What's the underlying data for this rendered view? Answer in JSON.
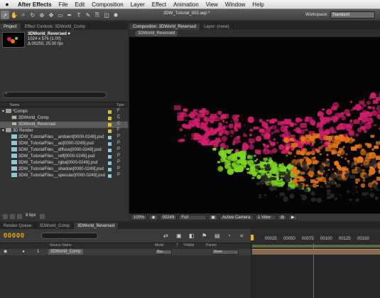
{
  "menubar": {
    "app": "After Effects",
    "items": [
      "File",
      "Edit",
      "Composition",
      "Layer",
      "Effect",
      "Animation",
      "View",
      "Window",
      "Help"
    ]
  },
  "toolbar": {
    "doc_title": "3DW_Tutorial_002.aep *",
    "workspace_label": "Workspace:",
    "workspace_value": "Standard"
  },
  "project": {
    "tabs": [
      "Project",
      "Effect Controls: 3DWorld_Comp"
    ],
    "selected_name": "3DWorld_Reversed ▾",
    "selected_size": "1024 x 576 (1.00)",
    "selected_time": "Δ 00250, 25.00 fps",
    "column_name": "Name",
    "column_type": "Type",
    "items": [
      {
        "name": "*Comps",
        "kind": "folder",
        "type": "F"
      },
      {
        "name": "3DWorld_Comp",
        "kind": "comp",
        "type": "C"
      },
      {
        "name": "3DWorld_Reversed",
        "kind": "comp",
        "type": "C"
      },
      {
        "name": "3D Render",
        "kind": "folder",
        "type": "F"
      },
      {
        "name": "3DW_TutorialFiles__ambient[0000-0249].psd",
        "kind": "file",
        "type": "P"
      },
      {
        "name": "3DW_TutorialFiles__ao[0000-0249].psd",
        "kind": "file",
        "type": "P"
      },
      {
        "name": "3DW_TutorialFiles__diffuse[0000-0249].psd",
        "kind": "file",
        "type": "P"
      },
      {
        "name": "3DW_TutorialFiles__refl[0000-0249].psd",
        "kind": "file",
        "type": "P"
      },
      {
        "name": "3DW_TutorialFiles__rgba[0000-0249].psd",
        "kind": "file",
        "type": "P"
      },
      {
        "name": "3DW_TutorialFiles__shadow[0000-0249].psd",
        "kind": "file",
        "type": "P"
      },
      {
        "name": "3DW_TutorialFiles__specular[0000-0249].psd",
        "kind": "file",
        "type": "P"
      }
    ],
    "bpc": "8 bpc"
  },
  "composition": {
    "tabs": [
      "Composition: 3DWorld_Reversed",
      "Layer: (none)"
    ],
    "breadcrumb": "3DWorld_Reversed",
    "bottom": {
      "zoom": "100%",
      "timecode": "00249",
      "resolution": "Full",
      "camera": "Active Camera",
      "views": "1 View"
    }
  },
  "timeline": {
    "tabs": [
      "Render Queue",
      "3DWorld_Comp",
      "3DWorld_Reversed"
    ],
    "timecode": "00000",
    "ruler": [
      "00025",
      "00050",
      "00075",
      "00100",
      "00125",
      "00150"
    ],
    "columns": {
      "source": "Source Name",
      "mode": "Mode",
      "t": "T",
      "trkmat": "TrkMat",
      "parent": "Parent"
    },
    "layer": {
      "index": "1",
      "name": "3DWorld_Comp",
      "mode": "Nor...",
      "parent": "None"
    }
  },
  "colors": {
    "accent": "#f5b400",
    "magenta": "#d21e6b",
    "green": "#7ed321",
    "orange": "#e8771a",
    "label_yellow": "#d6c23a"
  }
}
